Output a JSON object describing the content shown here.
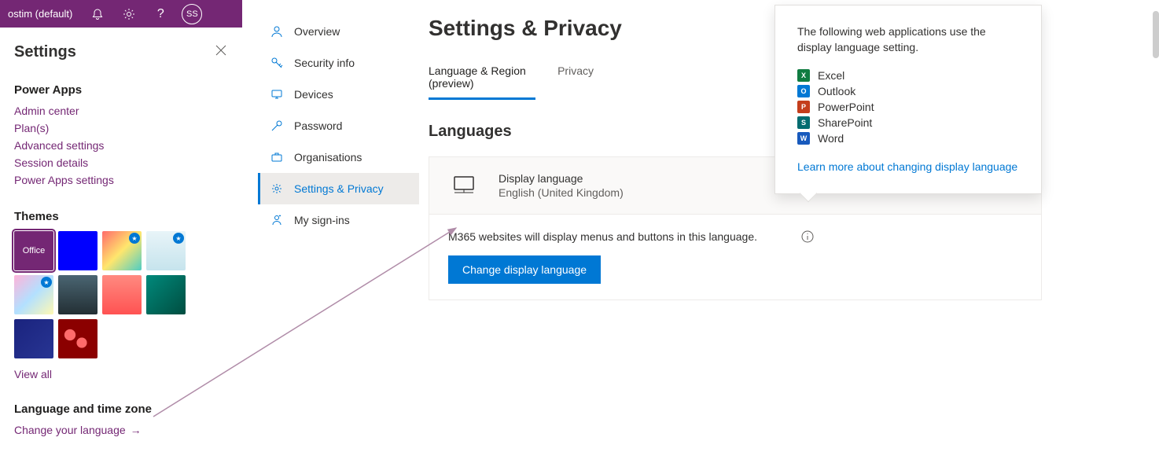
{
  "topbar": {
    "environment_label": "ostim (default)",
    "avatar_initials": "SS"
  },
  "settings_panel": {
    "title": "Settings",
    "sections": {
      "power_apps": {
        "title": "Power Apps",
        "links": [
          "Admin center",
          "Plan(s)",
          "Advanced settings",
          "Session details",
          "Power Apps settings"
        ]
      },
      "themes": {
        "title": "Themes",
        "view_all": "View all",
        "office_label": "Office"
      },
      "language": {
        "title": "Language and time zone",
        "link": "Change your language"
      }
    }
  },
  "nav_sidebar": {
    "items": [
      {
        "label": "Overview",
        "icon": "person"
      },
      {
        "label": "Security info",
        "icon": "key"
      },
      {
        "label": "Devices",
        "icon": "device"
      },
      {
        "label": "Password",
        "icon": "password"
      },
      {
        "label": "Organisations",
        "icon": "org"
      },
      {
        "label": "Settings & Privacy",
        "icon": "gear",
        "active": true
      },
      {
        "label": "My sign-ins",
        "icon": "signin"
      }
    ]
  },
  "main": {
    "title": "Settings & Privacy",
    "tabs": [
      {
        "label": "Language & Region (preview)",
        "active": true
      },
      {
        "label": "Privacy",
        "active": false
      }
    ],
    "languages_heading": "Languages",
    "display_language": {
      "title": "Display language",
      "value": "English (United Kingdom)"
    },
    "description": "M365 websites will display menus and buttons in this language.",
    "change_button": "Change display language"
  },
  "popover": {
    "text": "The following web applications use the display language setting.",
    "apps": [
      {
        "name": "Excel",
        "color": "#107c41",
        "letter": "X"
      },
      {
        "name": "Outlook",
        "color": "#0078d4",
        "letter": "O"
      },
      {
        "name": "PowerPoint",
        "color": "#c43e1c",
        "letter": "P"
      },
      {
        "name": "SharePoint",
        "color": "#036c70",
        "letter": "S"
      },
      {
        "name": "Word",
        "color": "#185abd",
        "letter": "W"
      }
    ],
    "learn_more": "Learn more about changing display language"
  }
}
